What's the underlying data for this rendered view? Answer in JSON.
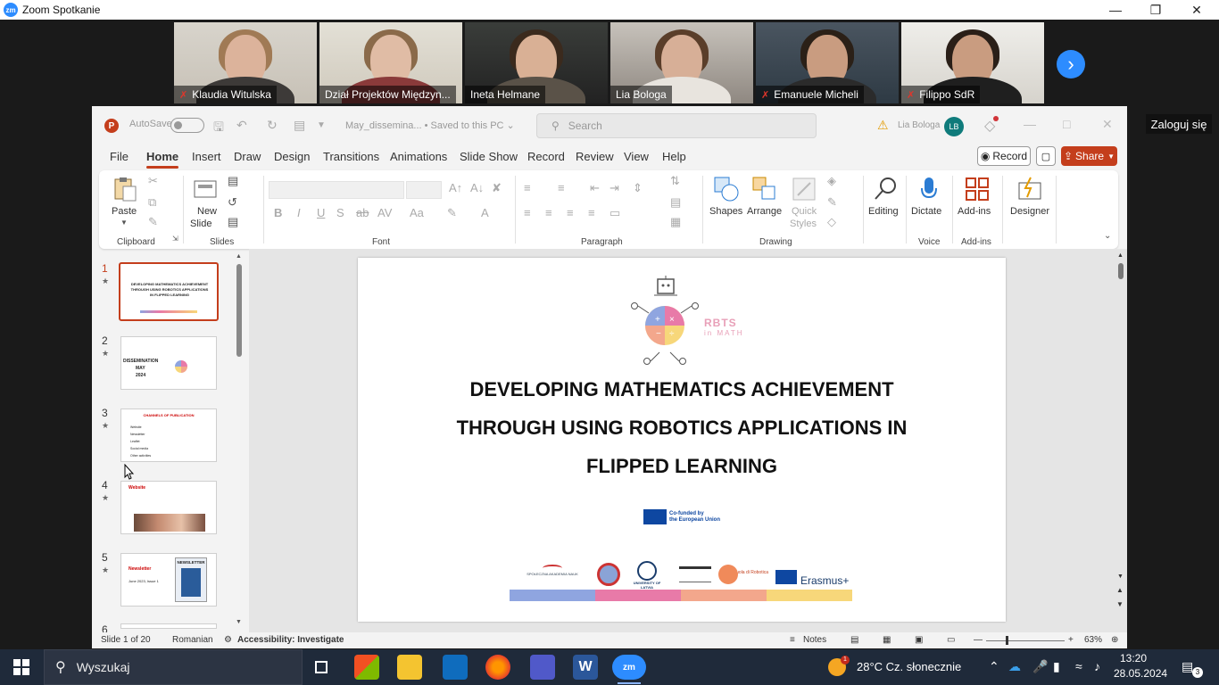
{
  "zoom": {
    "title": "Zoom Spotkanie",
    "logo": "zm",
    "signin_label": "Zaloguj się",
    "participants": [
      {
        "name": "Klaudia Witulska",
        "muted": true
      },
      {
        "name": "Dział Projektów Międzyn...",
        "muted": false
      },
      {
        "name": "Ineta Helmane",
        "muted": false,
        "active": true
      },
      {
        "name": "Lia Bologa",
        "muted": false
      },
      {
        "name": "Emanuele Micheli",
        "muted": true
      },
      {
        "name": "Filippo SdR",
        "muted": true
      }
    ]
  },
  "ppt": {
    "autosave_label": "AutoSave",
    "doc_name": "May_dissemina... • Saved to this PC ⌄",
    "search_placeholder": "Search",
    "user_name": "Lia Bologa",
    "user_initials": "LB",
    "menus": [
      "File",
      "Home",
      "Insert",
      "Draw",
      "Design",
      "Transitions",
      "Animations",
      "Slide Show",
      "Record",
      "Review",
      "View",
      "Help"
    ],
    "active_menu": "Home",
    "record_label": "Record",
    "share_label": "Share",
    "ribbon": {
      "paste": "Paste",
      "new_slide_1": "New",
      "new_slide_2": "Slide",
      "shapes": "Shapes",
      "arrange": "Arrange",
      "quick_styles_1": "Quick",
      "quick_styles_2": "Styles",
      "editing": "Editing",
      "dictate": "Dictate",
      "addins": "Add-ins",
      "designer": "Designer",
      "groups": {
        "clipboard": "Clipboard",
        "slides": "Slides",
        "font": "Font",
        "paragraph": "Paragraph",
        "drawing": "Drawing",
        "voice": "Voice",
        "addins": "Add-ins"
      }
    },
    "slides": [
      {
        "num": "1",
        "title": "DEVELOPING MATHEMATICS ACHIEVEMENT THROUGH USING ROBOTICS APPLICATIONS IN FLIPPED LEARNING"
      },
      {
        "num": "2",
        "title": "DISSEMINATION",
        "sub1": "MAY",
        "sub2": "2024"
      },
      {
        "num": "3",
        "title": "CHANNELS OF PUBLICATION",
        "bullets": [
          "Website",
          "Newsletter",
          "Leaflet",
          "Social media",
          "Other activities"
        ]
      },
      {
        "num": "4",
        "title": "Website"
      },
      {
        "num": "5",
        "title": "Newsletter",
        "sub": "June 2023, Issue 1",
        "badge": "NEWSLETTER"
      },
      {
        "num": "6",
        "title": ""
      }
    ],
    "current_slide": {
      "logo_text_1": "RBTS",
      "logo_text_2": "in MATH",
      "title_lines": [
        "DEVELOPING MATHEMATICS ACHIEVEMENT",
        "THROUGH USING ROBOTICS APPLICATIONS IN",
        "FLIPPED LEARNING"
      ],
      "eu_text_1": "Co-funded by",
      "eu_text_2": "the European Union",
      "partner_1": "SPOŁECZNA AKADEMIA NAUK",
      "partner_2": "UNIVERSITY OF LATVIA",
      "partner_3": "Scuola di Robotica",
      "erasmus": "Erasmus+"
    },
    "status": {
      "slide_count": "Slide 1 of 20",
      "language": "Romanian",
      "accessibility": "Accessibility: Investigate",
      "notes": "Notes",
      "zoom": "63%"
    }
  },
  "taskbar": {
    "search_placeholder": "Wyszukaj",
    "weather": "28°C  Cz. słonecznie",
    "weather_badge": "1",
    "time": "13:20",
    "date": "28.05.2024",
    "notifications": "3"
  }
}
